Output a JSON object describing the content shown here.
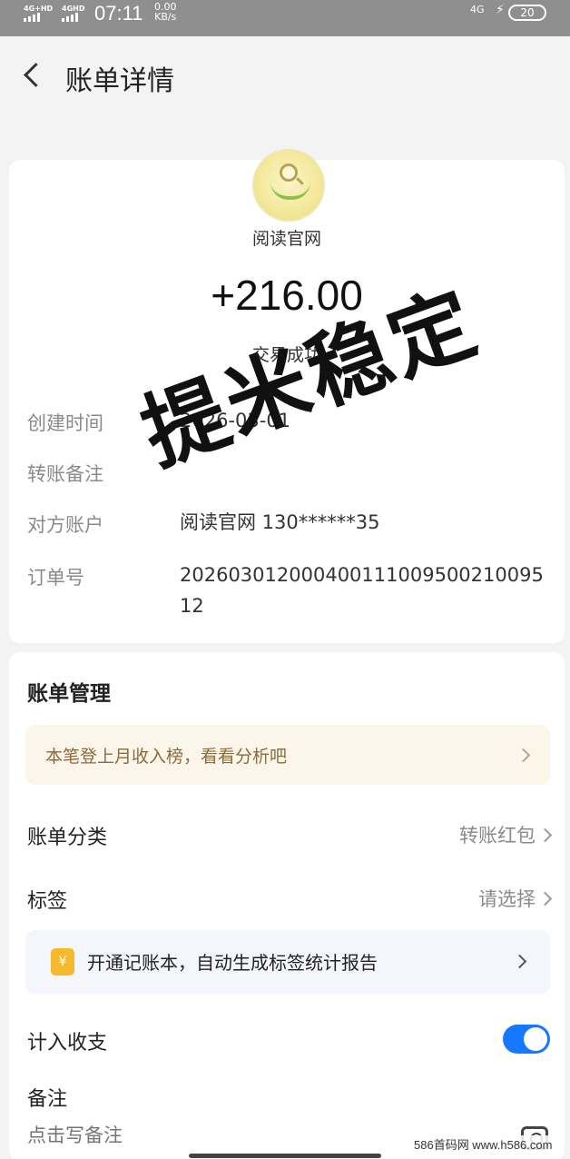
{
  "status_bar": {
    "signal1": "4G+HD",
    "signal2": "4GHD",
    "time": "07:11",
    "speed_value": "0.00",
    "speed_unit": "KB/s",
    "network": "4G",
    "battery": "20"
  },
  "nav": {
    "title": "账单详情"
  },
  "transaction": {
    "merchant": "阅读官网",
    "amount": "+216.00",
    "status": "交易成功",
    "details": [
      {
        "label": "创建时间",
        "value": "2026-03-01"
      },
      {
        "label": "转账备注",
        "value": ""
      },
      {
        "label": "对方账户",
        "value": "阅读官网 130******35"
      },
      {
        "label": "订单号",
        "value": "20260301200040011100950021009512"
      }
    ]
  },
  "watermark": "提米稳定",
  "bill_management": {
    "title": "账单管理",
    "banner": "本笔登上月收入榜，看看分析吧",
    "category_label": "账单分类",
    "category_value": "转账红包",
    "tag_label": "标签",
    "tag_value": "请选择",
    "promo_icon": "¥",
    "promo_text": "开通记账本，自动生成标签统计报告",
    "include_label": "计入收支",
    "include_on": true,
    "note_label": "备注",
    "note_placeholder": "点击写备注"
  },
  "site_mark": "586首码网 www.h586.com",
  "colors": {
    "accent": "#1677ff",
    "banner_bg": "#fcf6ea",
    "banner_text": "#8b6a3d"
  }
}
